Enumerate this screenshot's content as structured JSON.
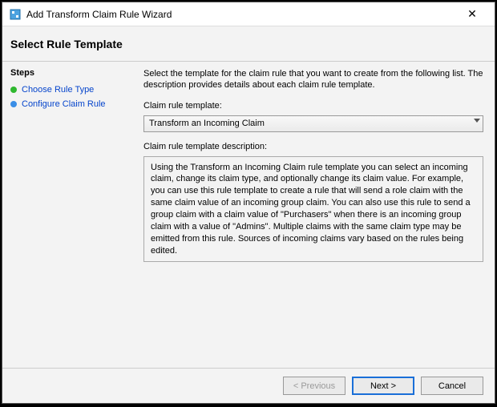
{
  "window": {
    "title": "Add Transform Claim Rule Wizard",
    "heading": "Select Rule Template"
  },
  "sidebar": {
    "heading": "Steps",
    "items": [
      {
        "label": "Choose Rule Type"
      },
      {
        "label": "Configure Claim Rule"
      }
    ]
  },
  "main": {
    "instruction": "Select the template for the claim rule that you want to create from the following list. The description provides details about each claim rule template.",
    "template_label": "Claim rule template:",
    "template_value": "Transform an Incoming Claim",
    "description_label": "Claim rule template description:",
    "description_text": "Using the Transform an Incoming Claim rule template you can select an incoming claim, change its claim type, and optionally change its claim value.  For example, you can use this rule template to create a rule that will send a role claim with the same claim value of an incoming group claim.  You can also use this rule to send a group claim with a claim value of \"Purchasers\" when there is an incoming group claim with a value of \"Admins\".  Multiple claims with the same claim type may be emitted from this rule.  Sources of incoming claims vary based on the rules being edited."
  },
  "footer": {
    "previous": "< Previous",
    "next": "Next >",
    "cancel": "Cancel"
  }
}
